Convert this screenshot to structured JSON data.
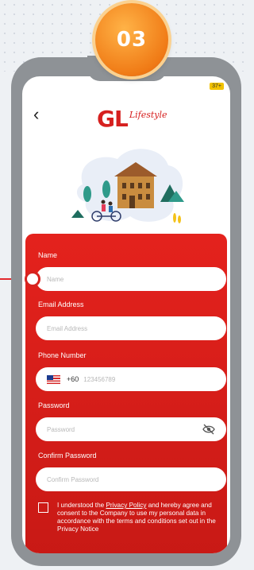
{
  "step": {
    "number": "03"
  },
  "status": {
    "indicator": "37+"
  },
  "header": {
    "back_icon": "chevron-left-icon",
    "logo_main": "GL",
    "logo_sub": "Lifestyle"
  },
  "form": {
    "fields": [
      {
        "label": "Name",
        "placeholder": "Name"
      },
      {
        "label": "Email Address",
        "placeholder": "Email Address"
      },
      {
        "label": "Phone Number",
        "country_code": "+60",
        "placeholder": "123456789"
      },
      {
        "label": "Password",
        "placeholder": "Password"
      },
      {
        "label": "Confirm Password",
        "placeholder": "Confirm Password"
      }
    ],
    "consent": {
      "prefix": "I understood the ",
      "link": "Privacy Policy",
      "suffix": " and hereby agree and consent to the Company to use my personal data in accordance with the terms and conditions set out in the Privacy Notice"
    }
  },
  "colors": {
    "brand_red": "#d6201f",
    "badge_orange": "#f07b16",
    "frame_gray": "#8e9296"
  }
}
